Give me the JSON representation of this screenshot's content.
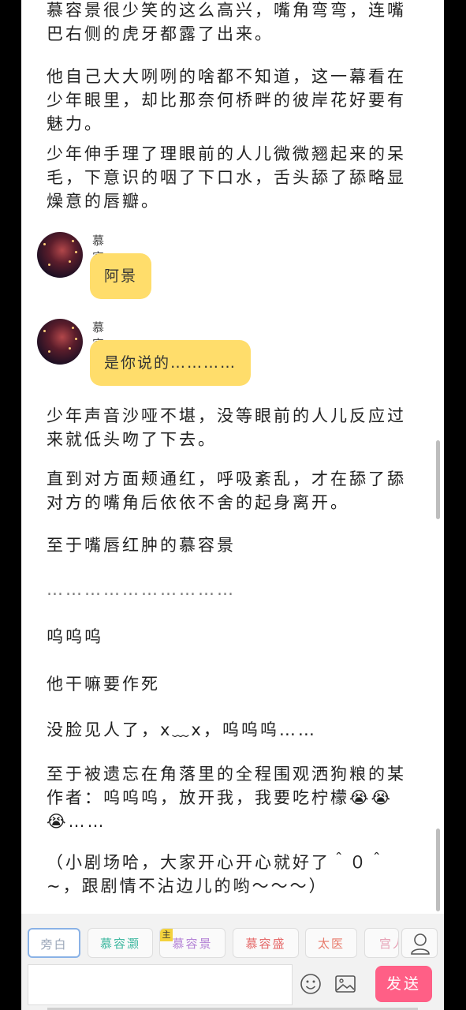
{
  "story": {
    "p1": "慕容景很少笑的这么高兴，嘴角弯弯，连嘴巴右侧的虎牙都露了出来。",
    "p2": "他自己大大咧咧的啥都不知道，这一幕看在少年眼里，却比那奈何桥畔的彼岸花好要有魅力。",
    "p3": "少年伸手理了理眼前的人儿微微翘起来的呆毛，下意识的咽了下口水，舌头舔了舔略显燥意的唇瓣。",
    "p4": "少年声音沙哑不堪，没等眼前的人儿反应过来就低头吻了下去。",
    "p5": "直到对方面颊通红，呼吸紊乱，才在舔了舔对方的嘴角后依依不舍的起身离开。",
    "p6": "至于嘴唇红肿的慕容景",
    "p7": "…………………………",
    "p8": "呜呜呜",
    "p9": "他干嘛要作死",
    "p10": "没脸见人了，x﹏x，呜呜呜……",
    "p11": "至于被遗忘在角落里的全程围观洒狗粮的某作者：呜呜呜，放开我，我要吃柠檬😭😭😭……",
    "p12": "（小剧场哈，大家开心开心就好了＾０＾~，跟剧情不沾边儿的哟～～～）"
  },
  "messages": [
    {
      "speaker": "慕容灏",
      "text": "阿景"
    },
    {
      "speaker": "慕容灏",
      "text": "是你说的…………"
    }
  ],
  "toolbar": {
    "roles": [
      {
        "label": "旁白",
        "color": "#9aa6b8"
      },
      {
        "label": "慕容灏",
        "color": "#3fb8a0"
      },
      {
        "label": "慕容景",
        "color": "#b482d6",
        "badge": "主"
      },
      {
        "label": "慕容盛",
        "color": "#e56868"
      },
      {
        "label": "太医",
        "color": "#e87a6b"
      },
      {
        "label": "宫人",
        "color": "#e6a0b4"
      }
    ],
    "send_label": "发送",
    "input_value": ""
  }
}
